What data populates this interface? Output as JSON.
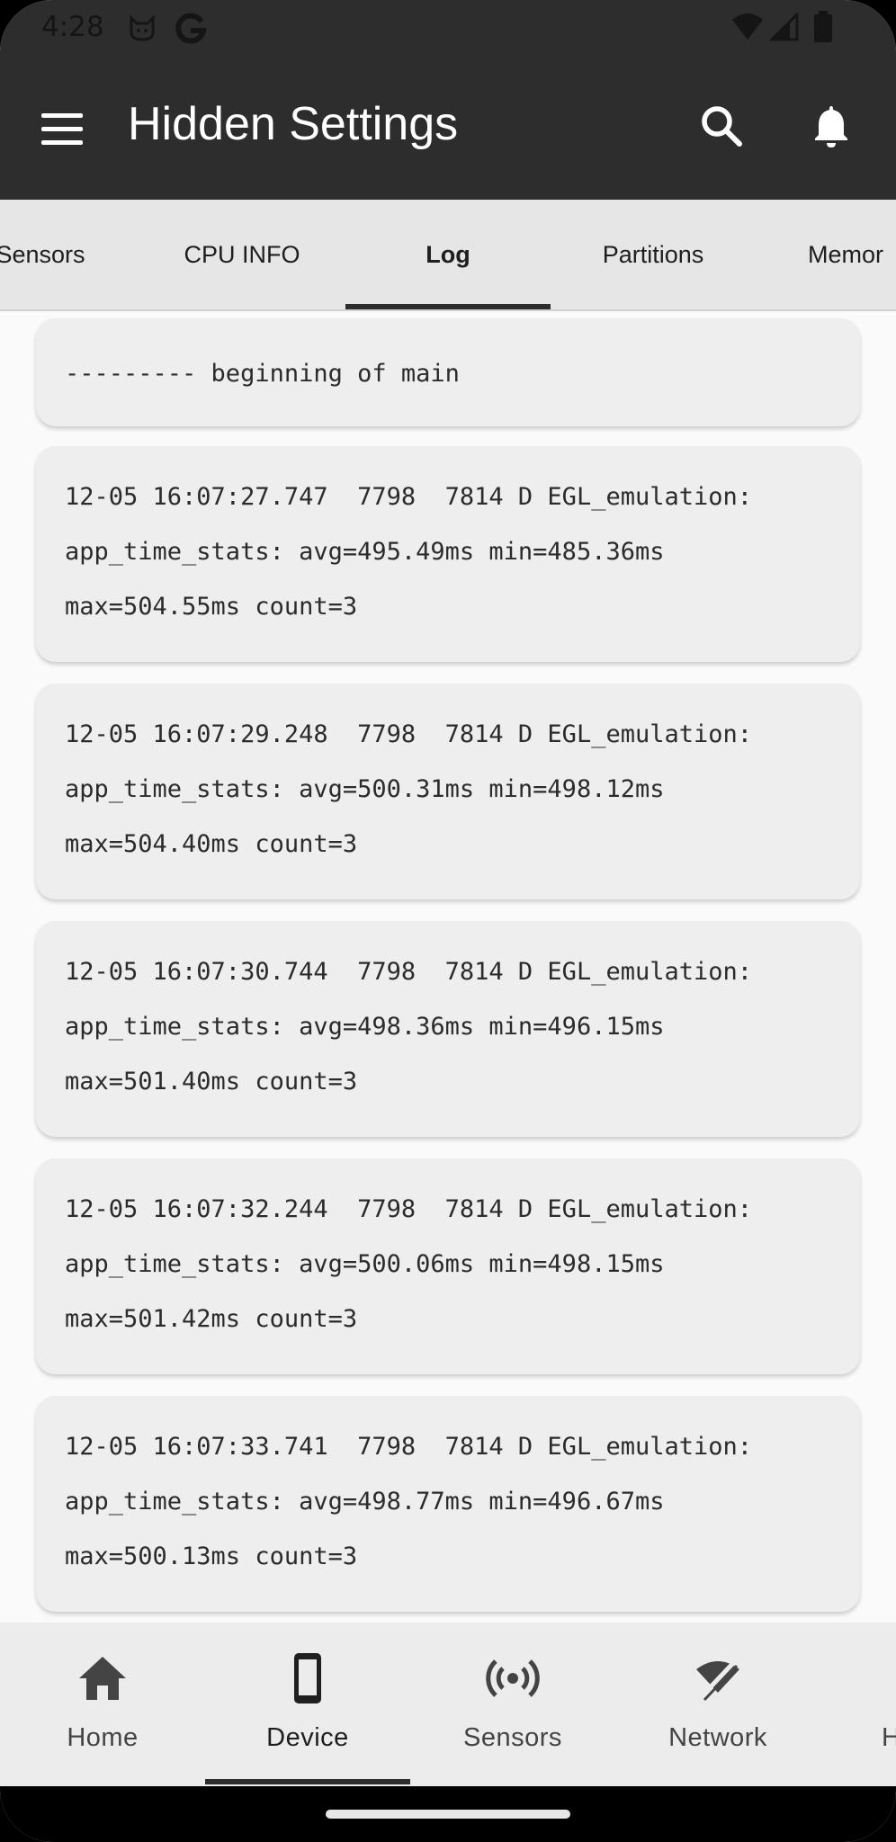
{
  "status_bar": {
    "time": "4:28",
    "icons": [
      "cat-face-icon",
      "google-g-icon",
      "wifi-icon",
      "signal-icon",
      "battery-icon"
    ]
  },
  "app_bar": {
    "title": "Hidden Settings",
    "icons": [
      "menu-icon",
      "search-icon",
      "bell-icon"
    ]
  },
  "tabs": {
    "items": [
      "Sensors",
      "CPU INFO",
      "Log",
      "Partitions",
      "Memor"
    ],
    "selected": "Log"
  },
  "log_entries": [
    {
      "text": "--------- beginning of main"
    },
    {
      "text": "12-05 16:07:27.747  7798  7814 D EGL_emulation:\napp_time_stats: avg=495.49ms min=485.36ms\nmax=504.55ms count=3"
    },
    {
      "text": "12-05 16:07:29.248  7798  7814 D EGL_emulation:\napp_time_stats: avg=500.31ms min=498.12ms\nmax=504.40ms count=3"
    },
    {
      "text": "12-05 16:07:30.744  7798  7814 D EGL_emulation:\napp_time_stats: avg=498.36ms min=496.15ms\nmax=501.40ms count=3"
    },
    {
      "text": "12-05 16:07:32.244  7798  7814 D EGL_emulation:\napp_time_stats: avg=500.06ms min=498.15ms\nmax=501.42ms count=3"
    },
    {
      "text": "12-05 16:07:33.741  7798  7814 D EGL_emulation:\napp_time_stats: avg=498.77ms min=496.67ms\nmax=500.13ms count=3"
    }
  ],
  "bottom_nav": {
    "items": [
      {
        "label": "Home",
        "icon": "home-icon"
      },
      {
        "label": "Device",
        "icon": "smartphone-icon"
      },
      {
        "label": "Sensors",
        "icon": "sensors-icon"
      },
      {
        "label": "Network",
        "icon": "wifi-off-icon"
      },
      {
        "label": "H",
        "icon": ""
      }
    ],
    "selected": "Device"
  },
  "colors": {
    "app_bar": "#2d2d2d",
    "tab_bar": "#e6e6e6",
    "card": "#eeeeee",
    "background": "#fafafa",
    "indicator": "#2d2d2d"
  }
}
